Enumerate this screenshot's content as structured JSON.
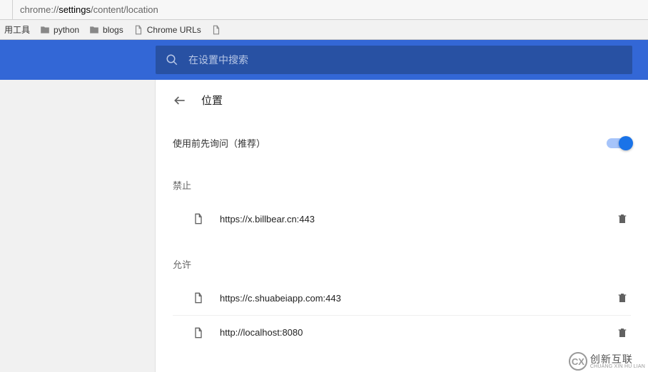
{
  "addressbar": {
    "prefix": "chrome://",
    "bold": "settings",
    "suffix": "/content/location"
  },
  "bookmarks": {
    "item1": "用工具",
    "item2": "python",
    "item3": "blogs",
    "item4": "Chrome URLs"
  },
  "search": {
    "placeholder": "在设置中搜索"
  },
  "page": {
    "title": "位置",
    "ask_label": "使用前先询问（推荐）",
    "toggle_on": true,
    "sections": {
      "block": {
        "label": "禁止",
        "sites": [
          "https://x.billbear.cn:443"
        ]
      },
      "allow": {
        "label": "允许",
        "sites": [
          "https://c.shuabeiapp.com:443",
          "http://localhost:8080"
        ]
      }
    }
  },
  "watermark": {
    "cn": "创新互联",
    "en": "CHUANG XIN HU LIAN"
  }
}
